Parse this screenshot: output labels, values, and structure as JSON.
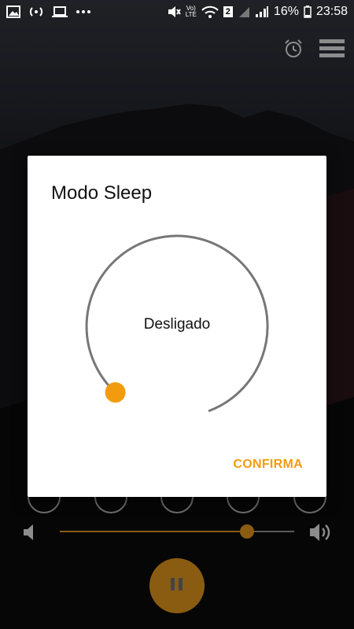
{
  "status_bar": {
    "battery_percent": "16%",
    "time": "23:58",
    "network_label": "LTE",
    "volte_label": "Vo)",
    "sim_label": "2"
  },
  "top_actions": {
    "alarm_icon": "alarm-clock-icon",
    "menu_icon": "hamburger-menu-icon"
  },
  "dialog": {
    "title": "Modo Sleep",
    "state_label": "Desligado",
    "confirm_label": "CONFIRMA",
    "timer_level": 0
  },
  "volume": {
    "level": 0.8
  },
  "colors": {
    "accent": "#f29c0d",
    "dial_stroke": "#777777",
    "dim_accent": "#8a5c12"
  },
  "player": {
    "state_icon": "pause-icon"
  }
}
